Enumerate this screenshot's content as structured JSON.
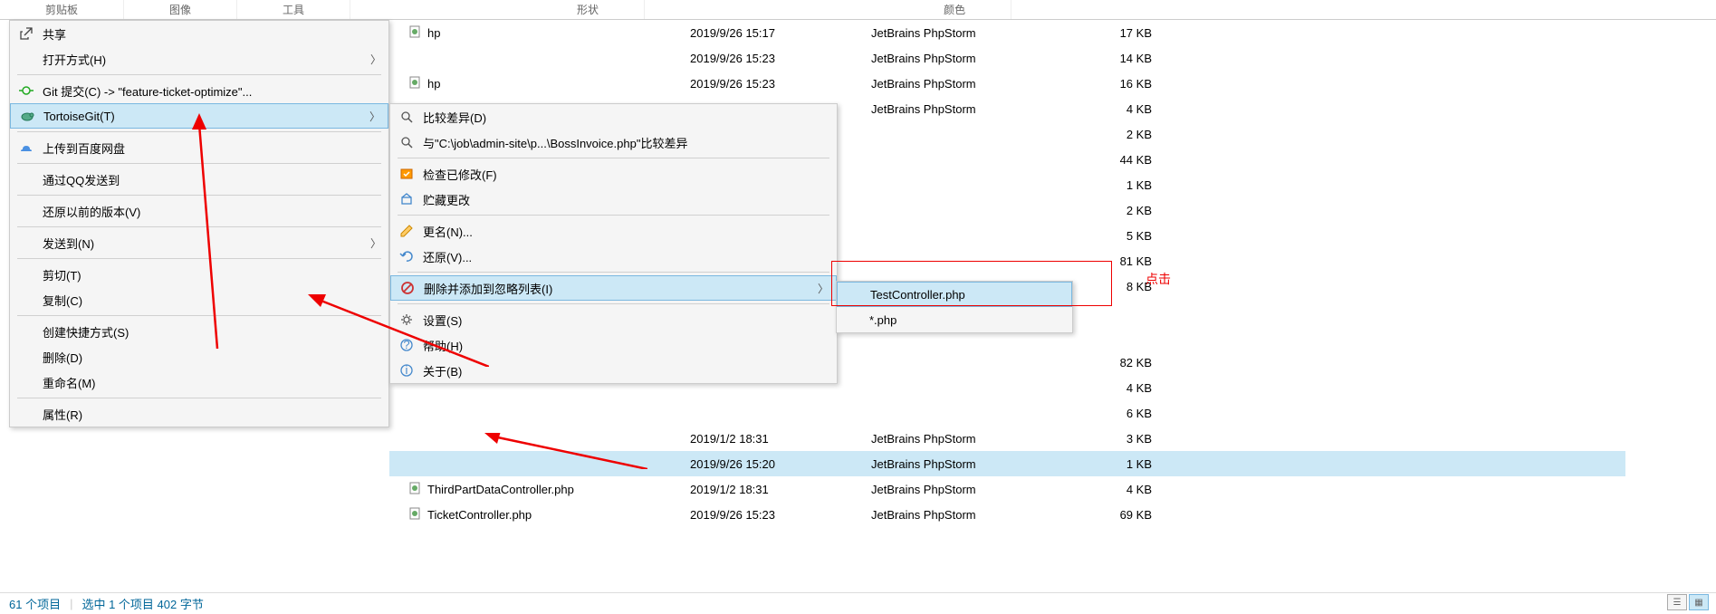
{
  "ribbon": {
    "clipboard": "剪贴板",
    "image": "图像",
    "tools": "工具",
    "shapes": "形状",
    "colors": "颜色"
  },
  "menu1": {
    "share": "共享",
    "open_with": "打开方式(H)",
    "git_commit": "Git 提交(C) -> \"feature-ticket-optimize\"...",
    "tortoise_git": "TortoiseGit(T)",
    "upload_baidu": "上传到百度网盘",
    "send_qq": "通过QQ发送到",
    "restore_prev": "还原以前的版本(V)",
    "send_to": "发送到(N)",
    "cut": "剪切(T)",
    "copy": "复制(C)",
    "shortcut": "创建快捷方式(S)",
    "delete": "删除(D)",
    "rename": "重命名(M)",
    "properties": "属性(R)"
  },
  "menu2": {
    "diff": "比较差异(D)",
    "diff_with": "与\"C:\\job\\admin-site\\p...\\BossInvoice.php\"比较差异",
    "check_mod": "检查已修改(F)",
    "stash": "贮藏更改",
    "rename": "更名(N)...",
    "revert": "还原(V)...",
    "del_ignore": "删除并添加到忽略列表(I)",
    "settings": "设置(S)",
    "help": "帮助(H)",
    "about": "关于(B)"
  },
  "menu3": {
    "item1": "TestController.php",
    "item2": "*.php"
  },
  "files": [
    {
      "name": "hp",
      "date": "2019/9/26 15:17",
      "type": "JetBrains PhpStorm",
      "size": "17 KB"
    },
    {
      "name": "",
      "date": "2019/9/26 15:23",
      "type": "JetBrains PhpStorm",
      "size": "14 KB"
    },
    {
      "name": "hp",
      "date": "2019/9/26 15:23",
      "type": "JetBrains PhpStorm",
      "size": "16 KB"
    },
    {
      "name": "",
      "date": "2019/9/26 15:23",
      "type": "JetBrains PhpStorm",
      "size": "4 KB"
    },
    {
      "name": "",
      "date": "",
      "type": "",
      "size": "2 KB"
    },
    {
      "name": "",
      "date": "",
      "type": "",
      "size": "44 KB"
    },
    {
      "name": "",
      "date": "",
      "type": "",
      "size": "1 KB"
    },
    {
      "name": "",
      "date": "",
      "type": "",
      "size": "2 KB"
    },
    {
      "name": "",
      "date": "",
      "type": "",
      "size": "5 KB"
    },
    {
      "name": "",
      "date": "",
      "type": "",
      "size": "81 KB"
    },
    {
      "name": "",
      "date": "",
      "type": "",
      "size": "8 KB"
    },
    {
      "name": "",
      "date": "",
      "type": "",
      "size": ""
    },
    {
      "name": "",
      "date": "",
      "type": "",
      "size": ""
    },
    {
      "name": "",
      "date": "",
      "type": "",
      "size": "82 KB"
    },
    {
      "name": "",
      "date": "",
      "type": "",
      "size": "4 KB"
    },
    {
      "name": "",
      "date": "",
      "type": "",
      "size": "6 KB"
    },
    {
      "name": "",
      "date": "2019/1/2 18:31",
      "type": "JetBrains PhpStorm",
      "size": "3 KB"
    },
    {
      "name": "",
      "date": "2019/9/26 15:20",
      "type": "JetBrains PhpStorm",
      "size": "1 KB",
      "selected": true
    },
    {
      "name": "ThirdPartDataController.php",
      "date": "2019/1/2 18:31",
      "type": "JetBrains PhpStorm",
      "size": "4 KB"
    },
    {
      "name": "TicketController.php",
      "date": "2019/9/26 15:23",
      "type": "JetBrains PhpStorm",
      "size": "69 KB"
    }
  ],
  "annotation": {
    "click": "点击"
  },
  "status": {
    "count": "61 个项目",
    "selected": "选中 1 个项目 402 字节"
  }
}
